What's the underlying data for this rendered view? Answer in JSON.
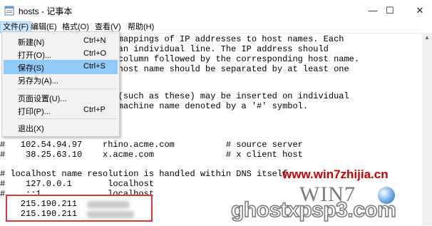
{
  "window": {
    "title": "hosts - 记事本",
    "minimize": "—",
    "maximize": "☐",
    "close": "✕"
  },
  "menubar": [
    {
      "label": "文件(F)"
    },
    {
      "label": "编辑(E)"
    },
    {
      "label": "格式(O)"
    },
    {
      "label": "查看(V)"
    },
    {
      "label": "帮助(H)"
    }
  ],
  "file_menu": [
    {
      "label": "新建(N)",
      "shortcut": "Ctrl+N"
    },
    {
      "label": "打开(O)...",
      "shortcut": "Ctrl+O"
    },
    {
      "label": "保存(S)",
      "shortcut": "Ctrl+S"
    },
    {
      "label": "另存为(A)...",
      "shortcut": ""
    },
    {
      "label": "页面设置(U)...",
      "shortcut": ""
    },
    {
      "label": "打印(P)...",
      "shortcut": "Ctrl+P"
    },
    {
      "label": "退出(X)",
      "shortcut": ""
    }
  ],
  "editor": {
    "lines": [
      "                       mappings of IP addresses to host names. Each",
      "                       an individual line. The IP address should",
      "                       column followed by the corresponding host name.",
      "                       host name should be separated by at least one",
      "",
      "                       (such as these) may be inserted on individual",
      "                       machine name denoted by a '#' symbol.",
      "",
      "",
      "#   102.54.94.97    rhino.acme.com          # source server",
      "#    38.25.63.10    x.acme.com              # x client host",
      "",
      "# localhost name resolution is handled within DNS itself.",
      "#    127.0.0.1       localhost",
      "#    ::1             localhost",
      "    215.190.211",
      "    215.190.211"
    ]
  },
  "watermark": {
    "url": "www.win7zhijia.cn",
    "logo": "WIN7",
    "site": "ghostxpsp3.com"
  }
}
